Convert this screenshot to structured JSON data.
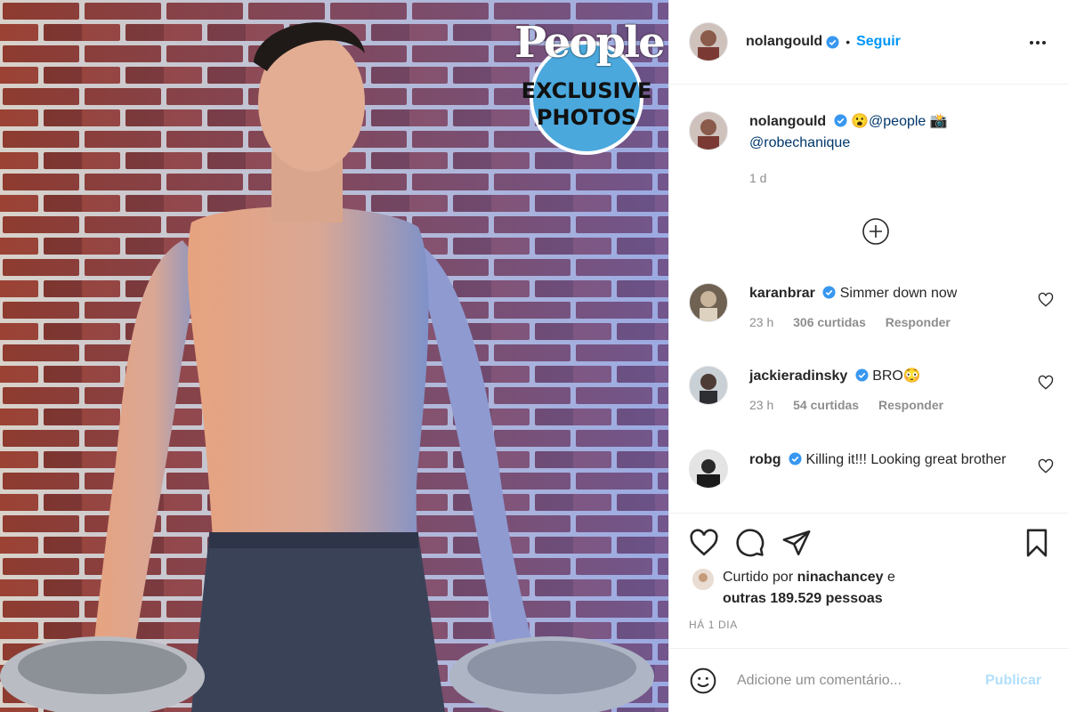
{
  "media": {
    "badge": {
      "brand": "People",
      "line1": "EXCLUSIVE",
      "line2": "PHOTOS",
      "circle_color": "#4aa8dd"
    }
  },
  "header": {
    "username": "nolangould",
    "separator": "•",
    "follow_label": "Seguir",
    "more_icon": "ellipsis-icon"
  },
  "caption": {
    "username": "nolangould",
    "emoji": "😮",
    "mention1": "@people",
    "camera": "📸",
    "mention2": "@robechanique",
    "time": "1 d"
  },
  "comments": [
    {
      "username": "karanbrar",
      "text": "Simmer down now",
      "time": "23 h",
      "likes": "306 curtidas",
      "reply": "Responder"
    },
    {
      "username": "jackieradinsky",
      "text": "BRO😳",
      "time": "23 h",
      "likes": "54 curtidas",
      "reply": "Responder"
    },
    {
      "username": "robg",
      "text": "Killing it!!! Looking great brother"
    }
  ],
  "footer": {
    "liked_prefix": "Curtido por ",
    "liked_user": "ninachancey",
    "liked_and": " e",
    "liked_others": "outras 189.529 pessoas",
    "date": "HÁ 1 DIA",
    "comment_placeholder": "Adicione um comentário...",
    "publish_label": "Publicar"
  },
  "colors": {
    "accent": "#0095f6",
    "publish_disabled": "#b2dffc",
    "muted": "#8e8e8e"
  }
}
